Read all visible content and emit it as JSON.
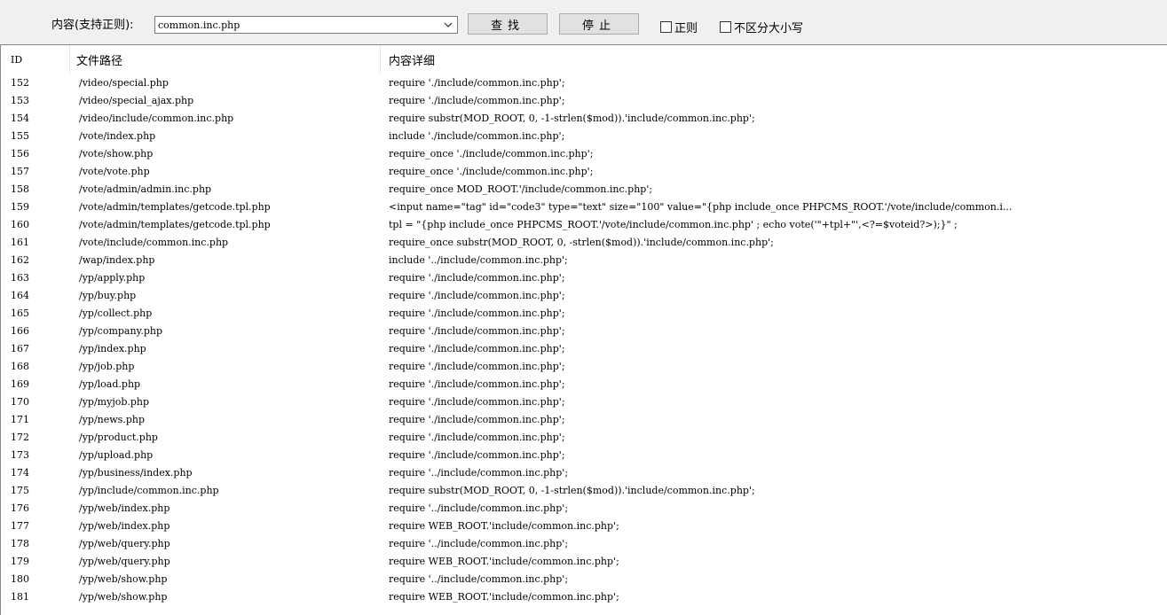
{
  "toolbar": {
    "search_label": "内容(支持正则):",
    "search_value": "common.inc.php",
    "find_label": "查找",
    "stop_label": "停止",
    "regex_label": "正则",
    "ignore_case_label": "不区分大小写"
  },
  "table": {
    "columns": [
      "ID",
      "文件路径",
      "内容详细"
    ],
    "rows": [
      {
        "id": "152",
        "path": "/video/special.php",
        "detail": "require './include/common.inc.php';"
      },
      {
        "id": "153",
        "path": "/video/special_ajax.php",
        "detail": "require './include/common.inc.php';"
      },
      {
        "id": "154",
        "path": "/video/include/common.inc.php",
        "detail": "require substr(MOD_ROOT, 0, -1-strlen($mod)).'include/common.inc.php';"
      },
      {
        "id": "155",
        "path": "/vote/index.php",
        "detail": "include './include/common.inc.php';"
      },
      {
        "id": "156",
        "path": "/vote/show.php",
        "detail": "require_once './include/common.inc.php';"
      },
      {
        "id": "157",
        "path": "/vote/vote.php",
        "detail": "require_once './include/common.inc.php';"
      },
      {
        "id": "158",
        "path": "/vote/admin/admin.inc.php",
        "detail": "require_once MOD_ROOT.'/include/common.inc.php';"
      },
      {
        "id": "159",
        "path": "/vote/admin/templates/getcode.tpl.php",
        "detail": "<input name=\"tag\" id=\"code3\" type=\"text\" size=\"100\" value=\"{php include_once PHPCMS_ROOT.'/vote/include/common.i..."
      },
      {
        "id": "160",
        "path": "/vote/admin/templates/getcode.tpl.php",
        "detail": "tpl = \"{php include_once PHPCMS_ROOT.'/vote/include/common.inc.php' ; echo vote('\"+tpl+\"',<?=$voteid?>);}\" ;"
      },
      {
        "id": "161",
        "path": "/vote/include/common.inc.php",
        "detail": "require_once substr(MOD_ROOT, 0, -strlen($mod)).'include/common.inc.php';"
      },
      {
        "id": "162",
        "path": "/wap/index.php",
        "detail": "include '../include/common.inc.php';"
      },
      {
        "id": "163",
        "path": "/yp/apply.php",
        "detail": "require './include/common.inc.php';"
      },
      {
        "id": "164",
        "path": "/yp/buy.php",
        "detail": "require './include/common.inc.php';"
      },
      {
        "id": "165",
        "path": "/yp/collect.php",
        "detail": "require './include/common.inc.php';"
      },
      {
        "id": "166",
        "path": "/yp/company.php",
        "detail": "require './include/common.inc.php';"
      },
      {
        "id": "167",
        "path": "/yp/index.php",
        "detail": "require './include/common.inc.php';"
      },
      {
        "id": "168",
        "path": "/yp/job.php",
        "detail": "require './include/common.inc.php';"
      },
      {
        "id": "169",
        "path": "/yp/load.php",
        "detail": "require './include/common.inc.php';"
      },
      {
        "id": "170",
        "path": "/yp/myjob.php",
        "detail": "require './include/common.inc.php';"
      },
      {
        "id": "171",
        "path": "/yp/news.php",
        "detail": "require './include/common.inc.php';"
      },
      {
        "id": "172",
        "path": "/yp/product.php",
        "detail": "require './include/common.inc.php';"
      },
      {
        "id": "173",
        "path": "/yp/upload.php",
        "detail": "require './include/common.inc.php';"
      },
      {
        "id": "174",
        "path": "/yp/business/index.php",
        "detail": "require '../include/common.inc.php';"
      },
      {
        "id": "175",
        "path": "/yp/include/common.inc.php",
        "detail": "require substr(MOD_ROOT, 0, -1-strlen($mod)).'include/common.inc.php';"
      },
      {
        "id": "176",
        "path": "/yp/web/index.php",
        "detail": "require '../include/common.inc.php';"
      },
      {
        "id": "177",
        "path": "/yp/web/index.php",
        "detail": "require WEB_ROOT.'include/common.inc.php';"
      },
      {
        "id": "178",
        "path": "/yp/web/query.php",
        "detail": "require '../include/common.inc.php';"
      },
      {
        "id": "179",
        "path": "/yp/web/query.php",
        "detail": "require WEB_ROOT.'include/common.inc.php';"
      },
      {
        "id": "180",
        "path": "/yp/web/show.php",
        "detail": "require '../include/common.inc.php';"
      },
      {
        "id": "181",
        "path": "/yp/web/show.php",
        "detail": "require WEB_ROOT.'include/common.inc.php';"
      }
    ]
  }
}
